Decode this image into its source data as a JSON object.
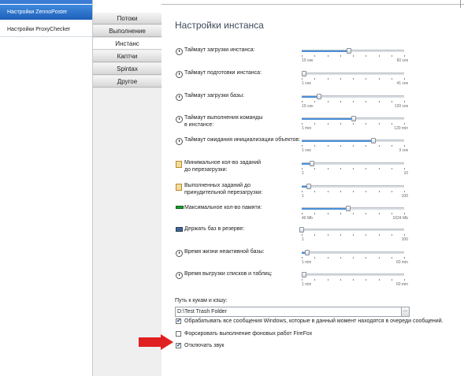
{
  "nav": {
    "items": [
      {
        "label": "Настройки ZennoPoster",
        "active": true
      },
      {
        "label": "Настройки ProxyChecker",
        "active": false
      }
    ]
  },
  "tabs": [
    {
      "label": "Потоки",
      "active": false
    },
    {
      "label": "Выполнение",
      "active": false
    },
    {
      "label": "Инстанс",
      "active": true
    },
    {
      "label": "Каптчи",
      "active": false
    },
    {
      "label": "Spintax",
      "active": false
    },
    {
      "label": "Другое",
      "active": false
    }
  ],
  "page": {
    "title": "Настройки инстанса"
  },
  "settings": [
    {
      "label": "Таймаут загрузки инстанса:",
      "min_label": "10 сек",
      "max_label": "60 сек",
      "value": 0.46
    },
    {
      "label": "Таймаут подготовки инстанса:",
      "min_label": "1 сек",
      "max_label": "41 сек",
      "value": 0.02
    },
    {
      "label": "Таймаут загрузки базы:",
      "min_label": "10 сек",
      "max_label": "120 сек",
      "value": 0.17
    },
    {
      "label": "Таймаут выполнения команды\nв инстансе:",
      "min_label": "1 min",
      "max_label": "120 min",
      "value": 0.51
    },
    {
      "label": "Таймаут ожидания инициализации объектов:",
      "min_label": "1 сек",
      "max_label": "3 сек",
      "value": 0.7
    },
    {
      "label": "Минимальное кол-во заданий\nдо перезагрузки:",
      "min_label": "1",
      "max_label": "10",
      "value": 0.1
    },
    {
      "label": "Выполненных заданий до\nпринудительной перезагрузки:",
      "min_label": "1",
      "max_label": "100",
      "value": 0.07
    },
    {
      "label": "Максимальное кол-во памяти:",
      "min_label": "40 Mb",
      "max_label": "1024 Mb",
      "value": 0.45
    },
    {
      "label": "Держать баз в резерве:",
      "min_label": "1",
      "max_label": "100",
      "value": 0.0
    },
    {
      "label": "Время жизни неактивной базы:",
      "min_label": "1 min",
      "max_label": "60 min",
      "value": 0.05
    },
    {
      "label": "Время выгрузки списков и таблиц:",
      "min_label": "1 min",
      "max_label": "60 min",
      "value": 0.02
    }
  ],
  "cookies": {
    "label": "Путь к кукам и кэшу:",
    "path": "D:\\Test Trash Folder",
    "browse_label": "..."
  },
  "checkboxes": [
    {
      "label": "Обрабатывать все сообщения Windows, которые в данный момент находятся в очереди сообщений.",
      "checked": true
    },
    {
      "label": "Форсировать выполнение фоновых работ FireFox",
      "checked": false
    },
    {
      "label": "Отключать звук",
      "checked": true
    }
  ],
  "colors": {
    "accent": "#3a7bd5",
    "slider_fill": "#4a8fd9",
    "arrow": "#e02020"
  }
}
